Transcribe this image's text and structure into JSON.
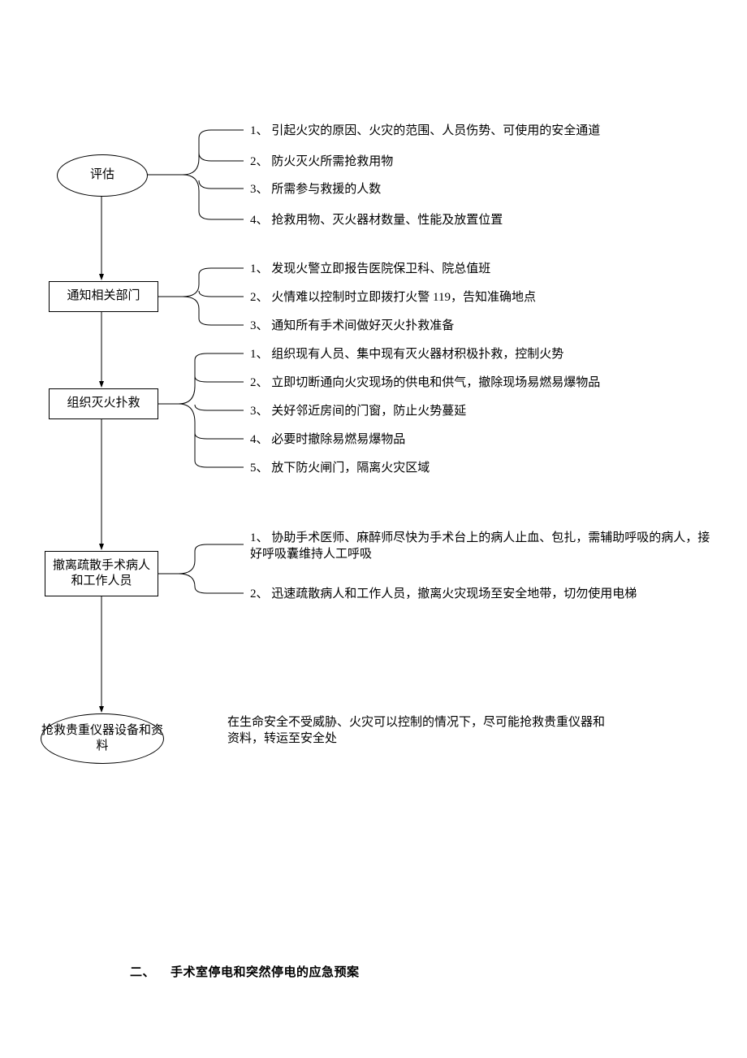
{
  "nodes": {
    "n1": {
      "label": "评估"
    },
    "n2": {
      "label": "通知相关部门"
    },
    "n3": {
      "label": "组织灭火扑救"
    },
    "n4": {
      "label": "撤离疏散手术病人和工作人员"
    },
    "n5": {
      "label": "抢救贵重仪器设备和资料"
    }
  },
  "details": {
    "n1": [
      "1、 引起火灾的原因、火灾的范围、人员伤势、可使用的安全通道",
      "2、 防火灭火所需抢救用物",
      "3、 所需参与救援的人数",
      "4、 抢救用物、灭火器材数量、性能及放置位置"
    ],
    "n2": [
      "1、 发现火警立即报告医院保卫科、院总值班",
      "2、 火情难以控制时立即拨打火警 119，告知准确地点",
      "3、 通知所有手术间做好灭火扑救准备"
    ],
    "n3": [
      "1、 组织现有人员、集中现有灭火器材积极扑救，控制火势",
      "2、 立即切断通向火灾现场的供电和供气，撤除现场易燃易爆物品",
      "3、 关好邻近房间的门窗，防止火势蔓延",
      "4、 必要时撤除易燃易爆物品",
      "5、 放下防火闸门，隔离火灾区域"
    ],
    "n4": [
      "1、 协助手术医师、麻醉师尽快为手术台上的病人止血、包扎，需辅助呼吸的病人，接好呼吸囊维持人工呼吸",
      "2、 迅速疏散病人和工作人员，撤离火灾现场至安全地带，切勿使用电梯"
    ],
    "n5": "在生命安全不受威胁、火灾可以控制的情况下，尽可能抢救贵重仪器和资料，转运至安全处"
  },
  "footer": {
    "marker": "二、",
    "title": "手术室停电和突然停电的应急预案"
  }
}
